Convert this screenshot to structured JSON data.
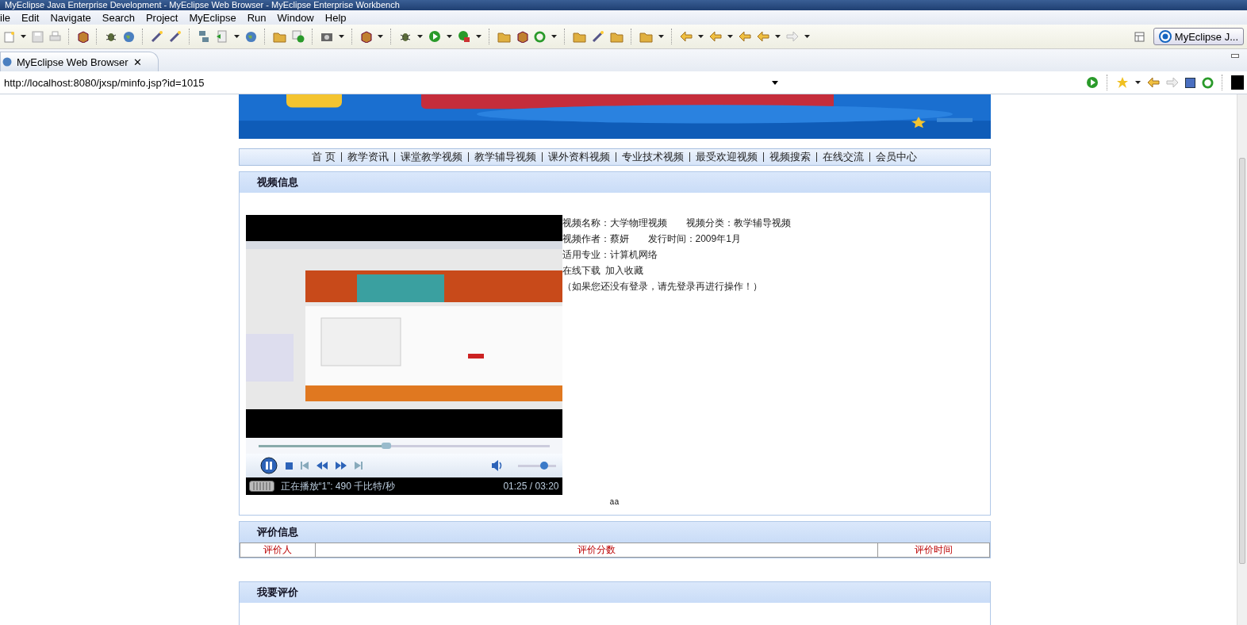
{
  "window": {
    "title": "MyEclipse Java Enterprise Development - MyEclipse Web Browser - MyEclipse Enterprise Workbench"
  },
  "menu": [
    "ile",
    "Edit",
    "Navigate",
    "Search",
    "Project",
    "MyEclipse",
    "Run",
    "Window",
    "Help"
  ],
  "perspective": {
    "label": "MyEclipse J..."
  },
  "editor_tab": {
    "label": "MyEclipse Web Browser",
    "close": "✕"
  },
  "address": {
    "value": "http://localhost:8080/jxsp/minfo.jsp?id=1015"
  },
  "site": {
    "nav": [
      {
        "label": "首 页"
      },
      {
        "label": "教学资讯"
      },
      {
        "label": "课堂教学视频"
      },
      {
        "label": "教学辅导视频"
      },
      {
        "label": "课外资料视频"
      },
      {
        "label": "专业技术视频"
      },
      {
        "label": "最受欢迎视频"
      },
      {
        "label": "视频搜索"
      },
      {
        "label": "在线交流"
      },
      {
        "label": "会员中心"
      }
    ],
    "video_section": {
      "title": "视频信息",
      "player": {
        "seek": {
          "level": 0.44
        },
        "volume": {
          "level": 0.7
        },
        "status": "正在播放“1”: 490 千比特/秒",
        "time": "01:25 / 03:20"
      },
      "info": [
        {
          "label": "视频名称：",
          "value": "大学物理视频",
          "label2": "视频分类：",
          "value2": "教学辅导视频"
        },
        {
          "label": "视频作者：",
          "value": "蔡妍",
          "label2": "发行时间：",
          "value2": "2009年1月"
        },
        {
          "label": "适用专业：",
          "value": "计算机网络"
        }
      ],
      "links": [
        "在线下载",
        "加入收藏"
      ],
      "note": "（如果您还没有登录，请先登录再进行操作！）",
      "caption": "aa"
    },
    "review_section": {
      "title": "评价信息",
      "columns": [
        "评价人",
        "评价分数",
        "评价时间"
      ]
    },
    "comment_section": {
      "title": "我要评价"
    }
  }
}
